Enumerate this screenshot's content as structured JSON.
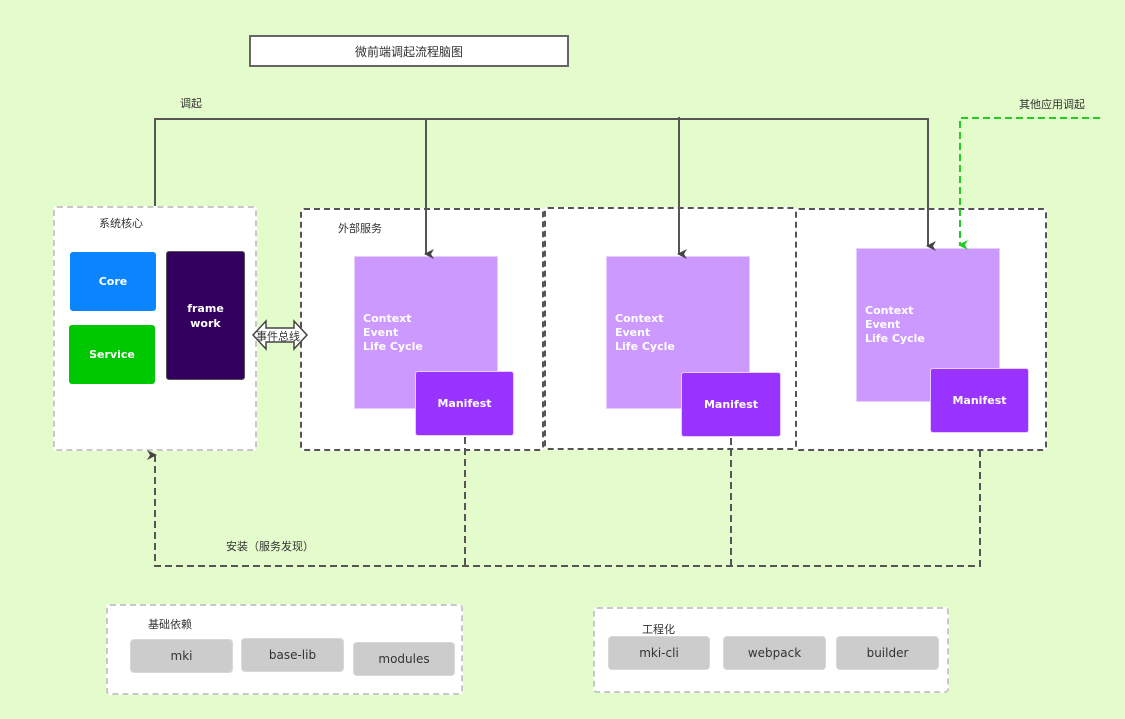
{
  "diagram": {
    "title": "微前端调起流程脑图",
    "invoke_label": "调起",
    "other_app_invoke_label": "其他应用调起",
    "install_label": "安装（服务发现）",
    "event_bus_label": "事件总线",
    "system_core": {
      "label": "系统核心",
      "core": "Core",
      "service": "Service",
      "framework_line1": "frame",
      "framework_line2": "work"
    },
    "external_services": {
      "label": "外部服务",
      "apps": [
        {
          "lines": [
            "Context",
            "Event",
            "Life Cycle"
          ],
          "manifest": "Manifest"
        },
        {
          "lines": [
            "Context",
            "Event",
            "Life Cycle"
          ],
          "manifest": "Manifest"
        },
        {
          "lines": [
            "Context",
            "Event",
            "Life Cycle"
          ],
          "manifest": "Manifest"
        }
      ]
    },
    "base_deps": {
      "label": "基础依赖",
      "items": [
        "mki",
        "base-lib",
        "modules"
      ]
    },
    "engineering": {
      "label": "工程化",
      "items": [
        "mki-cli",
        "webpack",
        "builder"
      ]
    },
    "colors": {
      "background": "#e4fccc",
      "core": "#0a84ff",
      "service": "#00c800",
      "framework": "#330060",
      "context": "#cc99ff",
      "manifest": "#9933ff",
      "chip": "#cccccc",
      "other_invoke_arrow": "#22cc22"
    }
  }
}
